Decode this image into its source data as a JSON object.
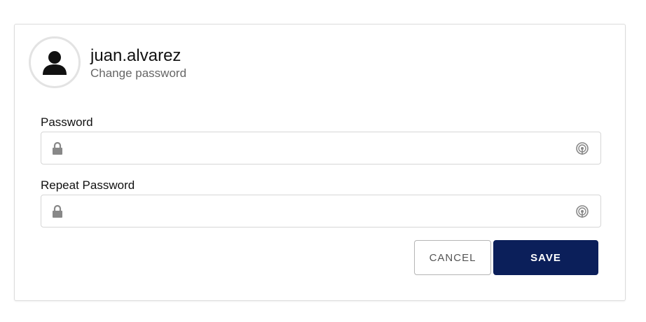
{
  "user": {
    "username": "juan.alvarez",
    "subtitle": "Change password",
    "avatar_icon": "person-icon"
  },
  "fields": [
    {
      "label": "Password",
      "value": "",
      "placeholder": "",
      "lock_icon": "lock-icon",
      "reveal_icon": "fingerprint-reveal-icon"
    },
    {
      "label": "Repeat Password",
      "value": "",
      "placeholder": "",
      "lock_icon": "lock-icon",
      "reveal_icon": "fingerprint-reveal-icon"
    }
  ],
  "actions": {
    "cancel_label": "CANCEL",
    "save_label": "SAVE"
  },
  "colors": {
    "primary": "#0b1f5a",
    "border": "#d6d6d6",
    "icon": "#888888"
  }
}
